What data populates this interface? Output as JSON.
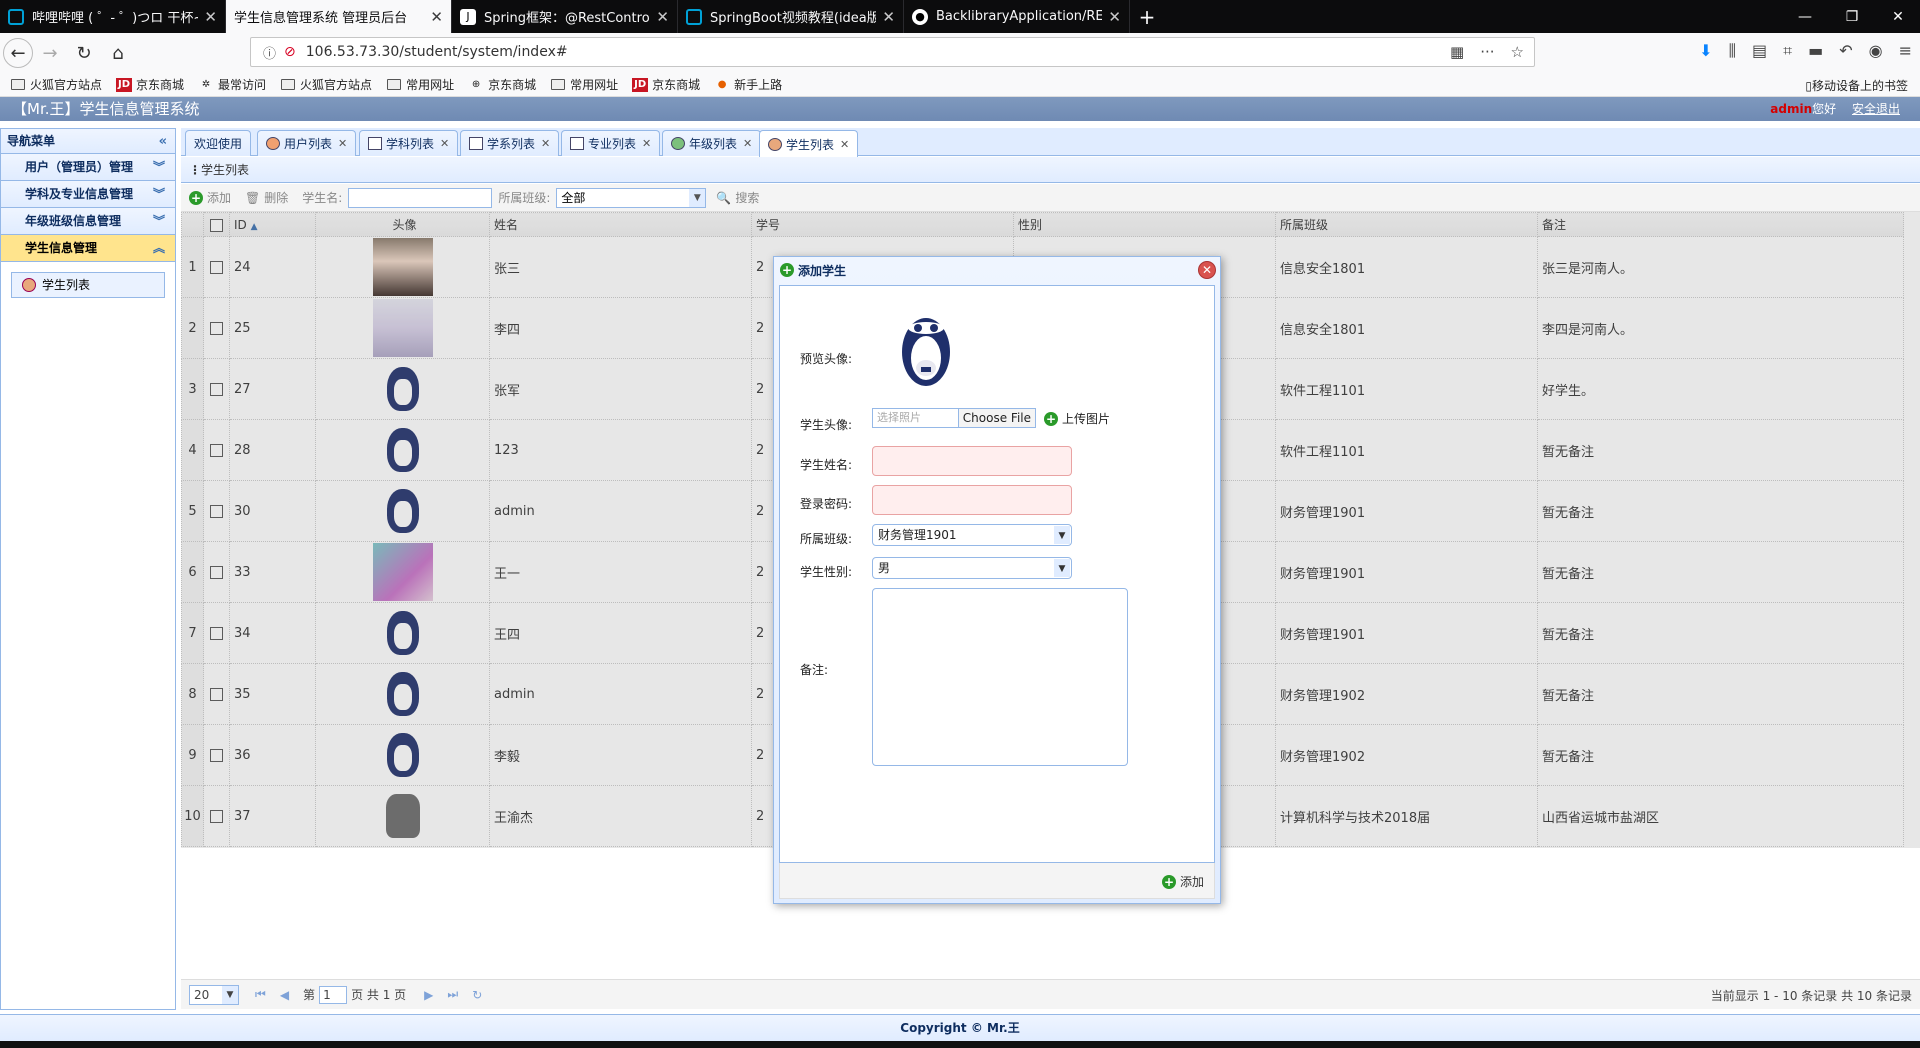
{
  "browser": {
    "tabs": [
      {
        "title": "哔哩哔哩 ( ゜- ゜)つロ 干杯~-bi",
        "icon": "bilibili-icon",
        "active": false
      },
      {
        "title": "学生信息管理系统 管理员后台",
        "icon": "",
        "active": true
      },
      {
        "title": "Spring框架：@RestControlle",
        "icon": "jianshu-icon",
        "active": false
      },
      {
        "title": "SpringBoot视频教程(idea版)_",
        "icon": "bilibili-icon",
        "active": false
      },
      {
        "title": "BacklibraryApplication/READ",
        "icon": "github-icon",
        "active": false
      }
    ],
    "url": "106.53.73.30/student/system/index#",
    "bookmarks": [
      "火狐官方站点",
      "京东商城",
      "最常访问",
      "火狐官方站点",
      "常用网址",
      "京东商城",
      "常用网址",
      "京东商城",
      "新手上路"
    ],
    "mobile_bookmarks": "移动设备上的书签"
  },
  "app": {
    "title": "【Mr.王】学生信息管理系统",
    "user": "admin",
    "greeting": "您好",
    "logout": "安全退出",
    "footer": "Copyright © Mr.王"
  },
  "sidebar": {
    "title": "导航菜单",
    "sections": [
      "用户（管理员）管理",
      "学科及专业信息管理",
      "年级班级信息管理",
      "学生信息管理"
    ],
    "item": "学生列表"
  },
  "tabs": [
    "欢迎使用",
    "用户列表",
    "学科列表",
    "学系列表",
    "专业列表",
    "年级列表",
    "学生列表"
  ],
  "panel_title": "学生列表",
  "toolbar": {
    "add": "添加",
    "delete": "删除",
    "name_label": "学生名:",
    "class_label": "所属班级:",
    "class_value": "全部",
    "search": "搜索"
  },
  "grid": {
    "columns": [
      "ID",
      "头像",
      "姓名",
      "学号",
      "性别",
      "所属班级",
      "备注"
    ],
    "rows": [
      {
        "n": "1",
        "id": "24",
        "name": "张三",
        "sno": "2",
        "cls": "信息安全1801",
        "note": "张三是河南人。"
      },
      {
        "n": "2",
        "id": "25",
        "name": "李四",
        "sno": "2",
        "cls": "信息安全1801",
        "note": "李四是河南人。"
      },
      {
        "n": "3",
        "id": "27",
        "name": "张军",
        "sno": "2",
        "cls": "软件工程1101",
        "note": "好学生。"
      },
      {
        "n": "4",
        "id": "28",
        "name": "123",
        "sno": "2",
        "cls": "软件工程1101",
        "note": "暂无备注"
      },
      {
        "n": "5",
        "id": "30",
        "name": "admin",
        "sno": "2",
        "cls": "财务管理1901",
        "note": "暂无备注"
      },
      {
        "n": "6",
        "id": "33",
        "name": "王一",
        "sno": "2",
        "cls": "财务管理1901",
        "note": "暂无备注"
      },
      {
        "n": "7",
        "id": "34",
        "name": "王四",
        "sno": "2",
        "cls": "财务管理1901",
        "note": "暂无备注"
      },
      {
        "n": "8",
        "id": "35",
        "name": "admin",
        "sno": "2",
        "cls": "财务管理1902",
        "note": "暂无备注"
      },
      {
        "n": "9",
        "id": "36",
        "name": "李毅",
        "sno": "2",
        "cls": "财务管理1902",
        "note": "暂无备注"
      },
      {
        "n": "10",
        "id": "37",
        "name": "王渝杰",
        "sno": "2",
        "cls": "计算机科学与技术2018届",
        "note": "山西省运城市盐湖区"
      }
    ]
  },
  "pager": {
    "page_size": "20",
    "page_prefix": "第",
    "page": "1",
    "page_suffix": "页 共 1 页",
    "info": "当前显示 1 - 10 条记录 共 10 条记录"
  },
  "dialog": {
    "title": "添加学生",
    "preview_label": "预览头像:",
    "avatar_label": "学生头像:",
    "avatar_placeholder": "选择照片",
    "choose_file": "Choose File",
    "upload": "上传图片",
    "name_label": "学生姓名:",
    "password_label": "登录密码:",
    "class_label": "所属班级:",
    "class_value": "财务管理1901",
    "gender_label": "学生性别:",
    "gender_value": "男",
    "note_label": "备注:",
    "add_button": "添加"
  }
}
